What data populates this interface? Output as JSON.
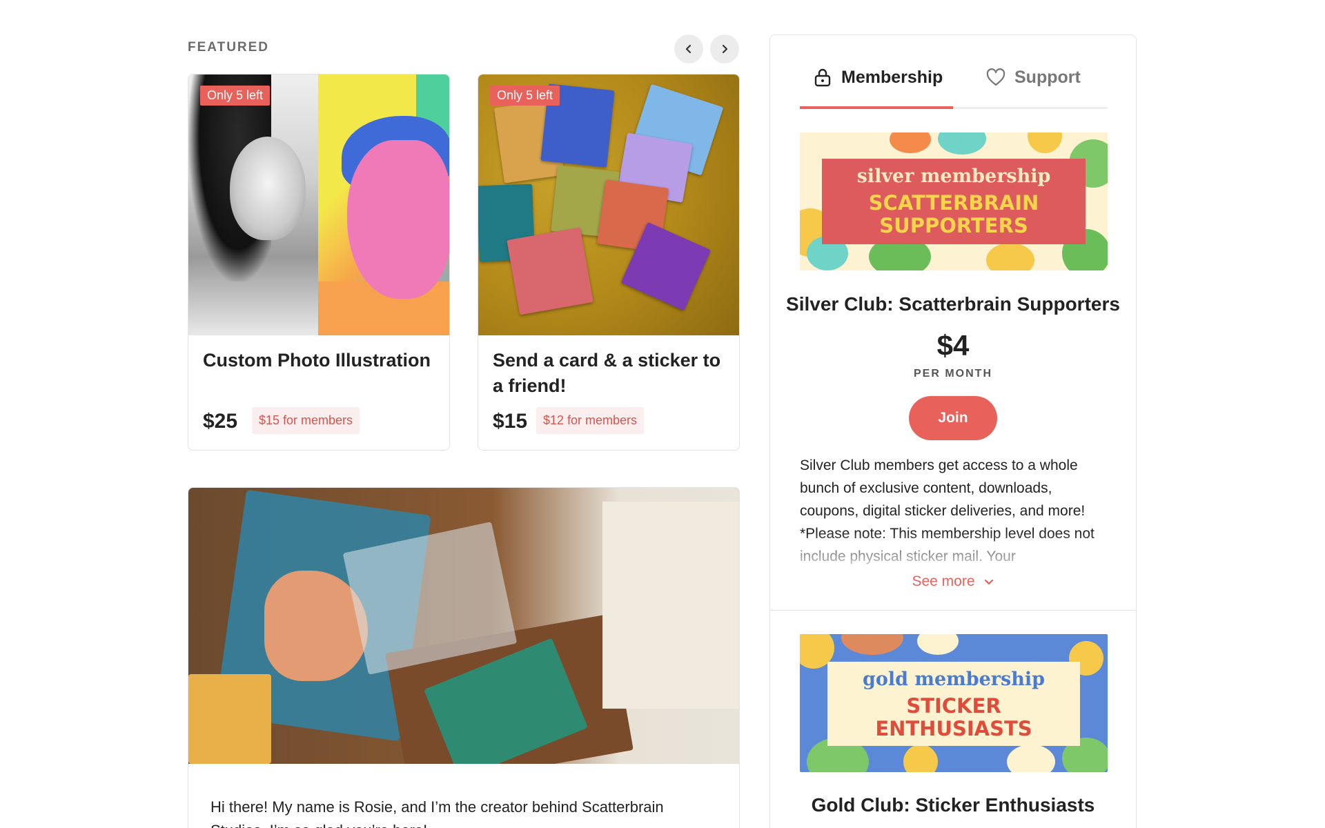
{
  "featured": {
    "label": "FEATURED",
    "prev_icon": "chevron-left-icon",
    "next_icon": "chevron-right-icon"
  },
  "products": [
    {
      "badge": "Only 5 left",
      "title": "Custom Photo Illustration",
      "price": "$25",
      "member_price": "$15 for members"
    },
    {
      "badge": "Only 5 left",
      "title": "Send a card & a sticker to a friend!",
      "price": "$15",
      "member_price": "$12 for members"
    }
  ],
  "story": {
    "text": "Hi there! My name is Rosie, and I’m the creator behind Scatterbrain Studios. I’m so glad you’re here!"
  },
  "panel": {
    "tabs": [
      {
        "label": "Membership",
        "icon": "lock-icon",
        "active": true
      },
      {
        "label": "Support",
        "icon": "heart-icon",
        "active": false
      }
    ],
    "tiers": [
      {
        "banner_script": "silver membership",
        "banner_line1": "SCATTERBRAIN",
        "banner_line2": "SUPPORTERS",
        "name": "Silver Club: Scatterbrain Supporters",
        "price": "$4",
        "period": "PER MONTH",
        "join_label": "Join",
        "description": "Silver Club members get access to a whole bunch of exclusive content, downloads, coupons, digital sticker deliveries, and more! *Please note: This membership level does not include physical sticker mail. Your",
        "see_more": "See more"
      },
      {
        "banner_script": "gold membership",
        "banner_line1": "STICKER",
        "banner_line2": "ENTHUSIASTS",
        "name": "Gold Club: Sticker Enthusiasts"
      }
    ]
  },
  "colors": {
    "accent": "#e8615a",
    "member_price_bg": "#fbeeee",
    "border": "#e3e3e3",
    "text": "#222222",
    "muted": "#6b6b6b"
  }
}
